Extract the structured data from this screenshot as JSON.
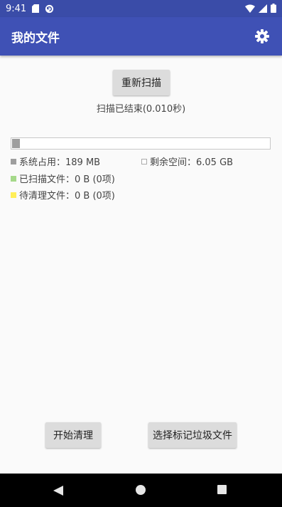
{
  "status_bar": {
    "time": "9:41"
  },
  "app_bar": {
    "title": "我的文件",
    "settings_icon": "gear-icon"
  },
  "rescan_button": {
    "label": "重新扫描"
  },
  "scan_status": "扫描已结束(0.010秒)",
  "storage_bar": {
    "used_fraction": 0.03
  },
  "legend": {
    "system_used": "系统占用：189 MB",
    "free_space": "剩余空间：6.05 GB",
    "scanned_files": "已扫描文件：0 B (0项)",
    "pending_clean": "待清理文件：0 B (0项)"
  },
  "colors": {
    "primary": "#3f51b5",
    "status_bar": "#3a4ca8",
    "system_used": "#9e9e9e",
    "scanned": "#a5d98a",
    "pending": "#ffee58"
  },
  "bottom_buttons": {
    "start_clean": "开始清理",
    "select_junk": "选择标记垃圾文件"
  },
  "nav_bar": {
    "back": "back-icon",
    "home": "home-icon",
    "recents": "recents-icon"
  }
}
